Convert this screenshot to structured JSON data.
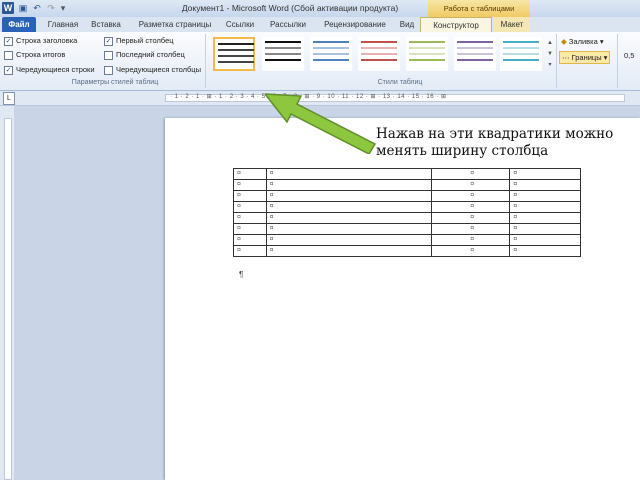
{
  "titlebar": {
    "app_icon": "W",
    "quick_access": [
      "save-icon",
      "undo-icon",
      "redo-icon"
    ],
    "title": "Документ1 - Microsoft Word (Сбой активации продукта)",
    "context_tab_group": "Работа с таблицами"
  },
  "tabs": [
    {
      "label": "Файл"
    },
    {
      "label": "Главная"
    },
    {
      "label": "Вставка"
    },
    {
      "label": "Разметка страницы"
    },
    {
      "label": "Ссылки"
    },
    {
      "label": "Рассылки"
    },
    {
      "label": "Рецензирование"
    },
    {
      "label": "Вид"
    },
    {
      "label": "Конструктор"
    },
    {
      "label": "Макет"
    }
  ],
  "ribbon": {
    "options_col1": [
      {
        "label": "Строка заголовка",
        "checked": true
      },
      {
        "label": "Строка итогов",
        "checked": false
      },
      {
        "label": "Чередующиеся строки",
        "checked": true
      }
    ],
    "options_col2": [
      {
        "label": "Первый столбец",
        "checked": true
      },
      {
        "label": "Последний столбец",
        "checked": false
      },
      {
        "label": "Чередующиеся столбцы",
        "checked": false
      }
    ],
    "group1_label": "Параметры стилей таблиц",
    "group2_label": "Стили таблиц",
    "shading_label": "Заливка",
    "borders_label": "Границы",
    "pen_weight": "0,5"
  },
  "ruler": {
    "tab_selector": "L",
    "numbers": "· 1 · 2 · 1 · ⊞ · 1 · 2 · 3 · 4 · 5 · 6 · 7 · 8 · ⊞ · 9 · 10 · 11 · 12 · ⊞ · 13 · 14 · 15 · 16 · ⊞"
  },
  "document": {
    "cell_mark": "¤",
    "paragraph_mark": "¶",
    "rows": 8
  },
  "annotation": {
    "text": "Нажав на эти квадратики можно менять ширину столбца"
  },
  "colors": {
    "file_tab": "#2a62b8",
    "arrow": "#8dc63f",
    "context_tab": "#f3c964"
  }
}
